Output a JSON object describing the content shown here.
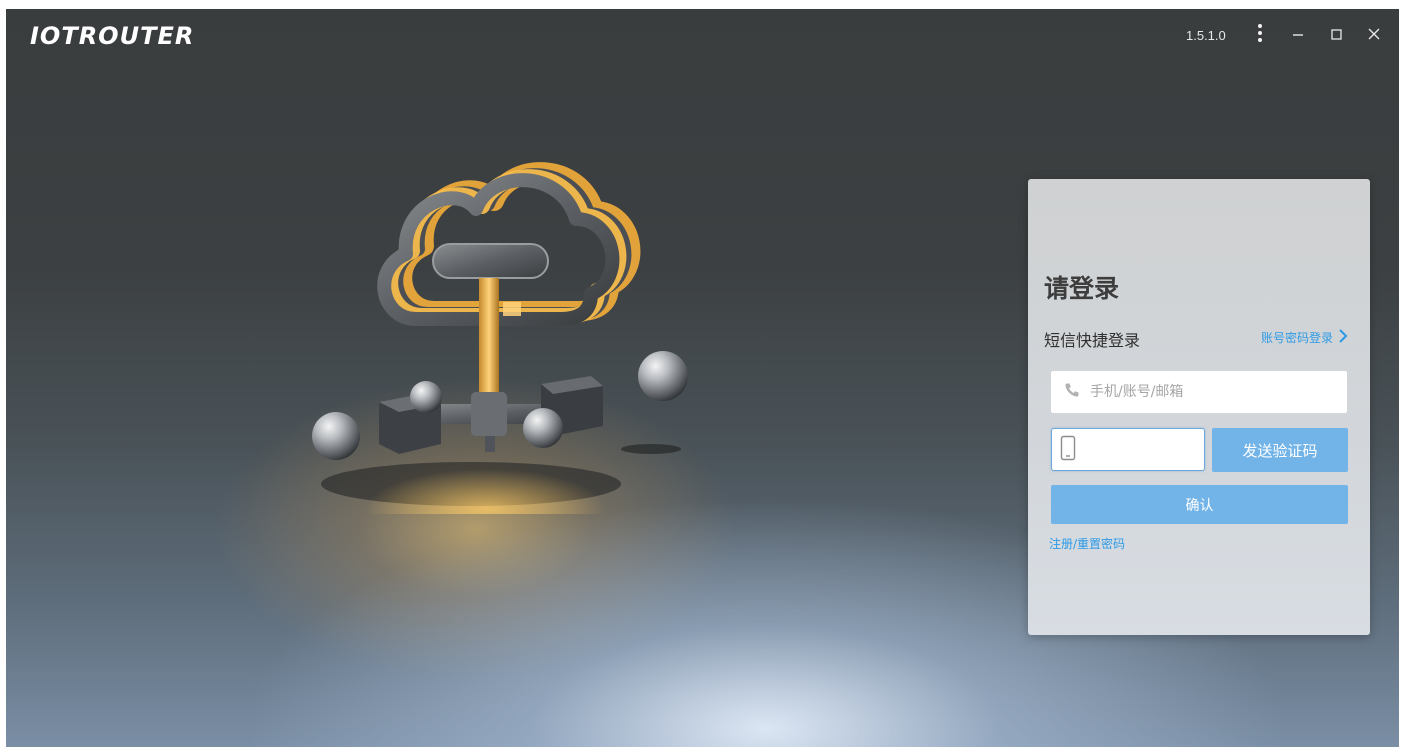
{
  "app": {
    "logo_text": "IOTROUTER",
    "version": "1.5.1.0"
  },
  "window_controls": {
    "menu_icon": "more-vertical-icon",
    "minimize_icon": "minimize-icon",
    "maximize_icon": "maximize-icon",
    "close_icon": "close-icon"
  },
  "illustration": {
    "icon": "cloud-network-illustration"
  },
  "login": {
    "title": "请登录",
    "subtitle": "短信快捷登录",
    "switch_link": "账号密码登录",
    "switch_icon": "chevron-right-icon",
    "account_placeholder": "手机/账号/邮箱",
    "account_icon": "phone-icon",
    "code_icon": "mobile-device-icon",
    "code_value": "",
    "send_code_label": "发送验证码",
    "confirm_label": "确认",
    "register_link": "注册/重置密码"
  },
  "colors": {
    "accent": "#2d9ae6",
    "button": "#73b4e8"
  }
}
